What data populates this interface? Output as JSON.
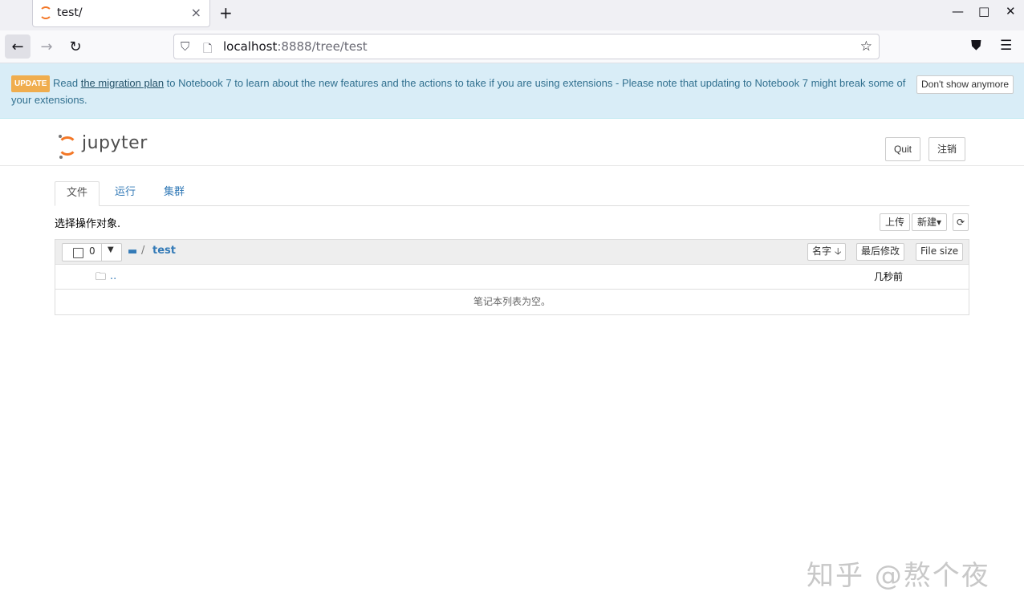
{
  "browser": {
    "tab_title": "test/",
    "tab_close": "×",
    "new_tab": "+",
    "url_host": "localhost",
    "url_rest": ":8888/tree/test",
    "window_controls": {
      "minimize": "—",
      "maximize": "□",
      "close": "✕"
    }
  },
  "banner": {
    "badge": "UPDATE",
    "text_before": "Read ",
    "link": "the migration plan",
    "text_after": " to Notebook 7 to learn about the new features and the actions to take if you are using extensions - Please note that updating to Notebook 7 might break some of your extensions.",
    "dismiss": "Don't show anymore"
  },
  "header": {
    "logo_text": "jupyter",
    "quit": "Quit",
    "logout": "注销"
  },
  "tabs": [
    {
      "label": "文件",
      "active": true
    },
    {
      "label": "运行",
      "active": false
    },
    {
      "label": "集群",
      "active": false
    }
  ],
  "toolbar": {
    "select_label": "选择操作对象.",
    "upload": "上传",
    "new": "新建",
    "new_caret": "▾",
    "refresh_icon": "⟳"
  },
  "list": {
    "selected_count": "0",
    "breadcrumb_sep": "/",
    "breadcrumb_dir": "test",
    "sort_name": "名字 🡣",
    "sort_modified": "最后修改",
    "sort_size": "File size",
    "rows": [
      {
        "name": "..",
        "modified": "几秒前"
      }
    ],
    "empty_message": "笔记本列表为空。"
  },
  "watermark": "知乎 @熬个夜"
}
